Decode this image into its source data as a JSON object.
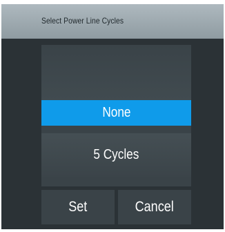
{
  "dialog": {
    "title": "Select Power Line Cycles"
  },
  "picker": {
    "options": [
      {
        "label": "",
        "selected": false
      },
      {
        "label": "None",
        "selected": true
      },
      {
        "label": "5 Cycles",
        "selected": false
      }
    ],
    "selected_index": 1
  },
  "buttons": {
    "set_label": "Set",
    "cancel_label": "Cancel"
  },
  "colors": {
    "title_bar": "#9aa5ab",
    "background": "#2b3236",
    "panel": "#3a4348",
    "selection": "#0f9bea",
    "text": "#ffffff"
  }
}
